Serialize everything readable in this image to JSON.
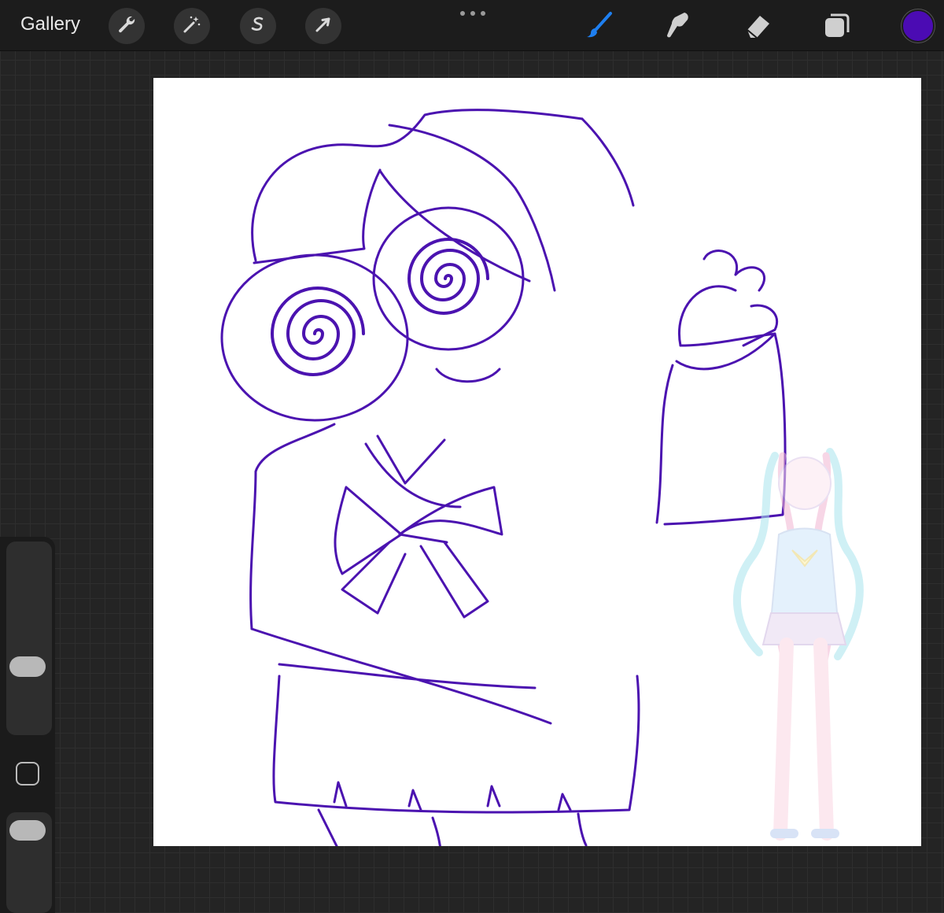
{
  "topbar": {
    "gallery_label": "Gallery",
    "actions": [
      {
        "name": "wrench-icon"
      },
      {
        "name": "magic-wand-icon"
      },
      {
        "name": "selection-s-icon"
      },
      {
        "name": "transform-arrow-icon"
      }
    ],
    "tools": [
      {
        "name": "brush-icon",
        "active": true
      },
      {
        "name": "smudge-icon",
        "active": false
      },
      {
        "name": "eraser-icon",
        "active": false
      },
      {
        "name": "layers-icon",
        "active": false
      }
    ],
    "active_color": "#4b0bb3"
  },
  "colors": {
    "accent_blue": "#1e7ff0",
    "stroke": "#4b13b0",
    "reference_pink": "#f2b6d2",
    "reference_cyan": "#a9e4ee"
  },
  "sidebar": {
    "brush_size_level": 0.2,
    "opacity_level": 0.0
  }
}
